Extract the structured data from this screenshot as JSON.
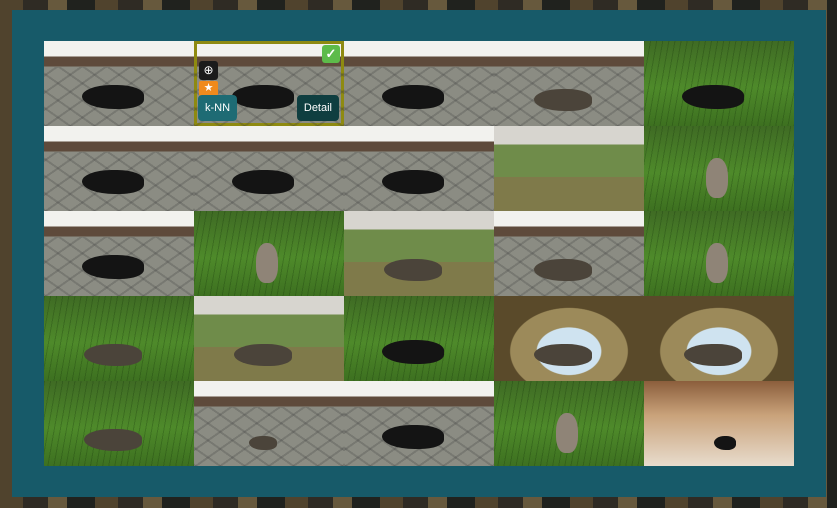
{
  "results": {
    "grid_columns": 5,
    "grid_rows": 5,
    "selected_index": 1,
    "accent_color": "#175a69",
    "selection_color": "#8e8a10",
    "tiles": [
      {
        "scene": "yard",
        "subject": "black-cat"
      },
      {
        "scene": "yard",
        "subject": "black-cat"
      },
      {
        "scene": "yard",
        "subject": "black-cat"
      },
      {
        "scene": "yard",
        "subject": "tabby-cat"
      },
      {
        "scene": "grass",
        "subject": "black-cat"
      },
      {
        "scene": "yard",
        "subject": "black-cat"
      },
      {
        "scene": "yard",
        "subject": "black-cat"
      },
      {
        "scene": "yard",
        "subject": "black-cat"
      },
      {
        "scene": "lawn",
        "subject": "garden"
      },
      {
        "scene": "grass",
        "subject": "squirrel"
      },
      {
        "scene": "yard",
        "subject": "black-cat"
      },
      {
        "scene": "grass",
        "subject": "squirrel"
      },
      {
        "scene": "lawn",
        "subject": "tabby-cat"
      },
      {
        "scene": "yard",
        "subject": "tabby-cat"
      },
      {
        "scene": "grass",
        "subject": "squirrel"
      },
      {
        "scene": "grass",
        "subject": "tabby-cat"
      },
      {
        "scene": "lawn",
        "subject": "tabby-cat"
      },
      {
        "scene": "grass",
        "subject": "black-cat"
      },
      {
        "scene": "basket",
        "subject": "tabby-cat"
      },
      {
        "scene": "basket",
        "subject": "tabby-cat"
      },
      {
        "scene": "grass",
        "subject": "tabby-cat"
      },
      {
        "scene": "yard",
        "subject": "cat"
      },
      {
        "scene": "yard",
        "subject": "black-cat"
      },
      {
        "scene": "grass",
        "subject": "squirrel"
      },
      {
        "scene": "creche",
        "subject": "figurines"
      }
    ]
  },
  "tile_actions": {
    "knn_label": "k-NN",
    "detail_label": "Detail",
    "zoom_icon": "zoom-in-icon",
    "favorite_icon": "star-icon",
    "selected_icon": "checkmark-icon"
  }
}
